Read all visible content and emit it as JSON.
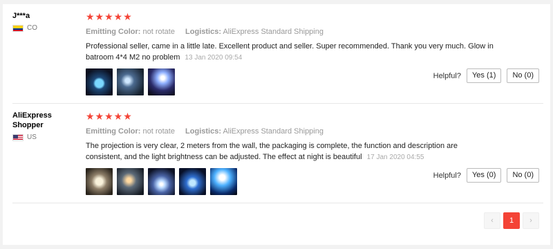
{
  "reviews": [
    {
      "user": "J***a",
      "country": "CO",
      "stars": "★★★★★",
      "emitting_color_label": "Emitting Color:",
      "emitting_color_value": "not rotate",
      "logistics_label": "Logistics:",
      "logistics_value": "AliExpress Standard Shipping",
      "text": "Professional seller, came in a little late. Excellent product and seller. Super recommended. Thank you very much. Glow in batroom 4*4 M2 no problem",
      "date": "13 Jan 2020 09:54",
      "helpful_label": "Helpful?",
      "yes_label": "Yes (1)",
      "no_label": "No (0)",
      "photos": [
        "photo-1",
        "photo-2",
        "photo-3"
      ]
    },
    {
      "user": "AliExpress Shopper",
      "country": "US",
      "stars": "★★★★★",
      "emitting_color_label": "Emitting Color:",
      "emitting_color_value": "not rotate",
      "logistics_label": "Logistics:",
      "logistics_value": "AliExpress Standard Shipping",
      "text": "The projection is very clear, 2 meters from the wall, the packaging is complete, the function and description are consistent, and the light brightness can be adjusted. The effect at night is beautiful",
      "date": "17 Jan 2020 04:55",
      "helpful_label": "Helpful?",
      "yes_label": "Yes (0)",
      "no_label": "No (0)",
      "photos": [
        "photo-1",
        "photo-2",
        "photo-3",
        "photo-4",
        "photo-5"
      ]
    }
  ],
  "pagination": {
    "prev_icon": "‹",
    "current_page": "1",
    "next_icon": "›"
  },
  "colors": {
    "accent": "#f44336",
    "muted_text": "#999999"
  }
}
